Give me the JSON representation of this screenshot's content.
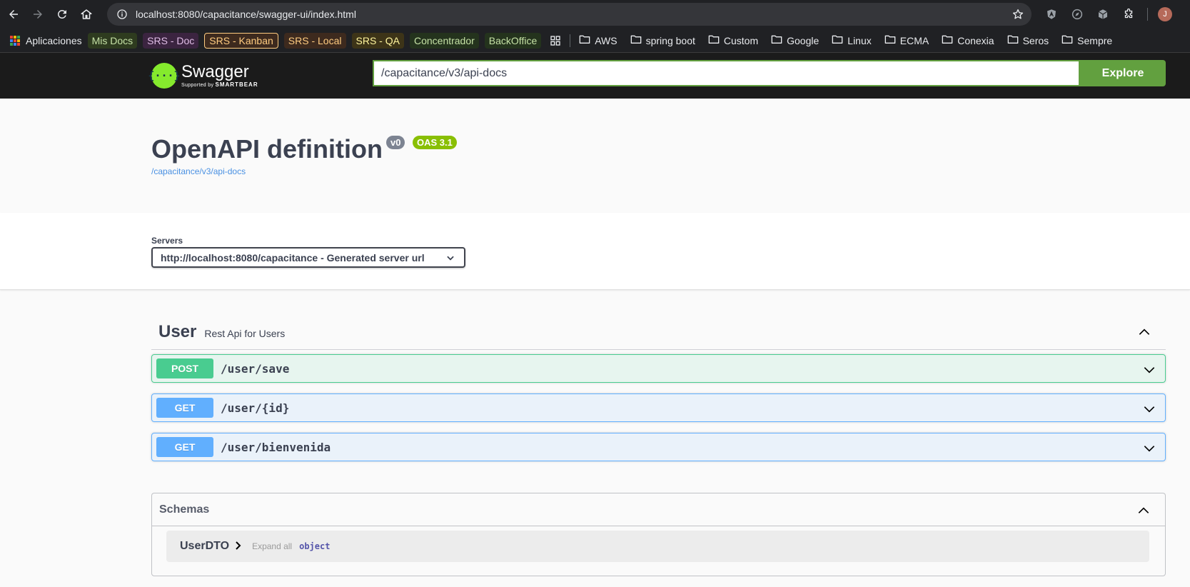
{
  "browser": {
    "url": "localhost:8080/capacitance/swagger-ui/index.html",
    "avatar_initial": "J"
  },
  "bookmarks": {
    "apps_label": "Aplicaciones",
    "colored": [
      {
        "label": "Mis Docs",
        "bg": "#2e3b1f",
        "color": "#c5e1a5"
      },
      {
        "label": "SRS - Doc",
        "bg": "#3b2440",
        "color": "#e1bee7"
      },
      {
        "label": "SRS - Kanban",
        "bg": "#3d2a1e",
        "color": "#ffcc80"
      },
      {
        "label": "SRS - Local",
        "bg": "#3d2a1e",
        "color": "#ffcc80"
      },
      {
        "label": "SRS - QA",
        "bg": "#3d3418",
        "color": "#fff59d"
      },
      {
        "label": "Concentrador",
        "bg": "#24331d",
        "color": "#c5e1a5"
      },
      {
        "label": "BackOffice",
        "bg": "#24331d",
        "color": "#c5e1a5"
      }
    ],
    "folders": [
      "AWS",
      "spring boot",
      "Custom",
      "Google",
      "Linux",
      "ECMA",
      "Conexia",
      "Seros",
      "Sempre"
    ]
  },
  "topbar": {
    "logo_title": "Swagger",
    "logo_sub_prefix": "Supported by",
    "logo_sub_brand": "SMARTBEAR",
    "explore_value": "/capacitance/v3/api-docs",
    "explore_label": "Explore"
  },
  "info": {
    "title": "OpenAPI definition",
    "version": "v0",
    "oas": "OAS 3.1",
    "spec_url": "/capacitance/v3/api-docs"
  },
  "servers": {
    "label": "Servers",
    "selected": "http://localhost:8080/capacitance - Generated server url"
  },
  "tag": {
    "name": "User",
    "description": "Rest Api for Users"
  },
  "operations": [
    {
      "method": "POST",
      "path": "/user/save"
    },
    {
      "method": "GET",
      "path": "/user/{id}"
    },
    {
      "method": "GET",
      "path": "/user/bienvenida"
    }
  ],
  "schemas": {
    "title": "Schemas",
    "models": [
      {
        "name": "UserDTO",
        "expand_label": "Expand all",
        "type": "object"
      }
    ]
  },
  "colors": {
    "swagger_green": "#85ea2d",
    "explore_green": "#62a03f",
    "post": "#49cc90",
    "get": "#61afe",
    "link_blue": "#4990e2"
  }
}
